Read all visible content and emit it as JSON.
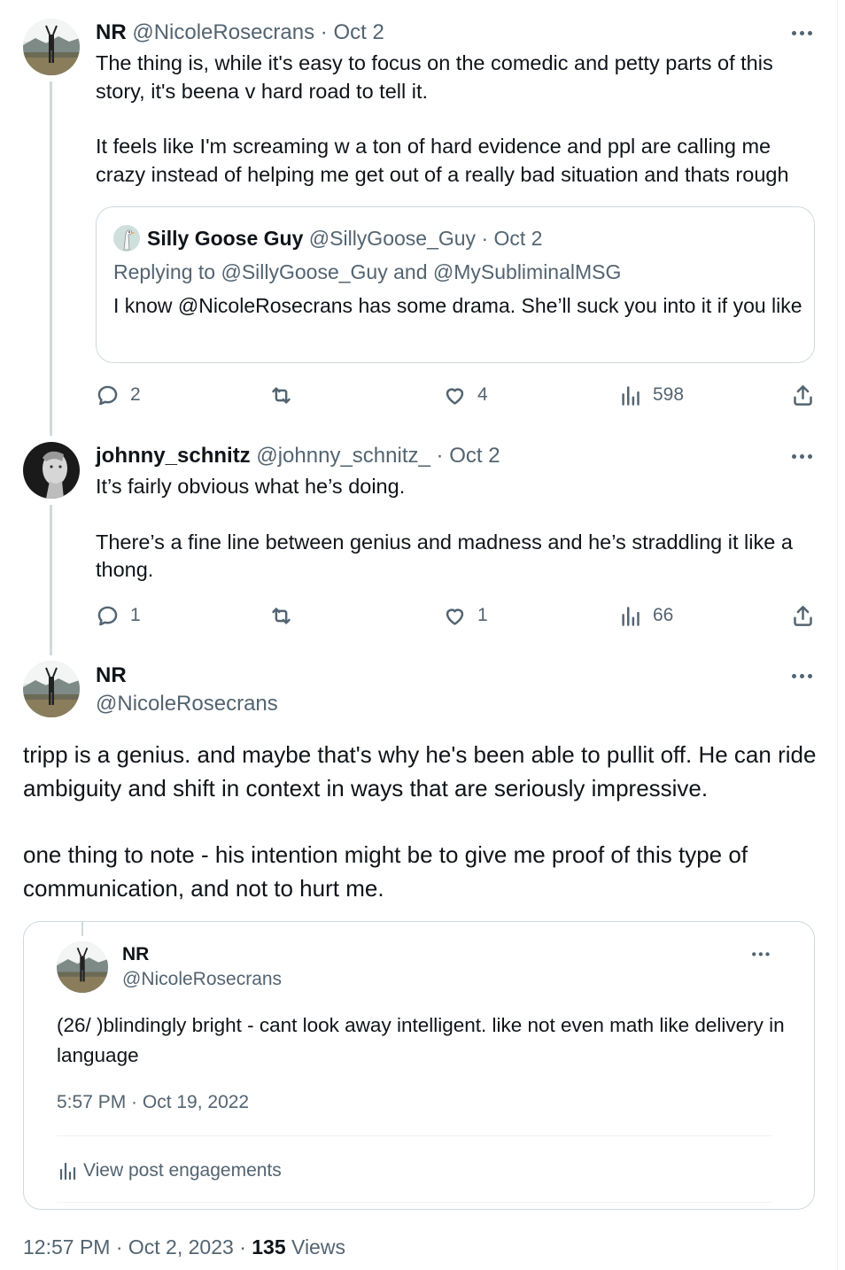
{
  "post1": {
    "name": "NR",
    "handle": "@NicoleRosecrans",
    "date": "Oct 2",
    "paragraphs": [
      "The thing is, while it's easy to focus on the comedic and petty parts of this story, it's beena v hard road to tell it.",
      "It feels like I'm screaming w a ton of hard evidence and ppl are calling me crazy instead of helping me get out of a really bad situation and thats rough"
    ],
    "quote": {
      "name": "Silly Goose Guy",
      "handle": "@SillyGoose_Guy",
      "date": "Oct 2",
      "replying_prefix": "Replying to",
      "replying_to_1": "@SillyGoose_Guy",
      "replying_and": "and",
      "replying_to_2": "@MySubliminalMSG",
      "text": "I know @NicoleRosecrans has some drama. She’ll suck you into it if you like"
    },
    "replies": "2",
    "reposts": "",
    "likes": "4",
    "views": "598"
  },
  "post2": {
    "name": "johnny_schnitz",
    "handle": "@johnny_schnitz_",
    "date": "Oct 2",
    "paragraphs": [
      "It’s fairly obvious what he’s doing.",
      "There’s a fine line between genius and madness and he’s straddling it like a thong."
    ],
    "replies": "1",
    "reposts": "",
    "likes": "1",
    "views": "66"
  },
  "main_post": {
    "name": "NR",
    "handle": "@NicoleRosecrans",
    "paragraphs": [
      "tripp is a genius. and maybe that's why he's been able to pullit off. He can ride ambiguity and shift in context in ways that are seriously impressive.",
      "one thing to note - his intention might be to give me proof of this type of communication, and not to hurt me."
    ],
    "quote": {
      "name": "NR",
      "handle": "@NicoleRosecrans",
      "text": "(26/ )blindingly bright - cant look away intelligent. like not even math like delivery in language",
      "timestamp": "5:57 PM · Oct 19, 2022",
      "engagements_label": "View post engagements"
    },
    "timestamp": "12:57 PM · Oct 2, 2023",
    "separator": "·",
    "views_count": "135",
    "views_label": "Views"
  },
  "icons": {
    "reply": "reply-icon",
    "repost": "repost-icon",
    "like": "heart-icon",
    "views": "analytics-icon",
    "share": "share-icon",
    "more": "more-icon"
  },
  "colors": {
    "text": "#0f1419",
    "muted": "#536471",
    "border": "#cfd9de"
  }
}
